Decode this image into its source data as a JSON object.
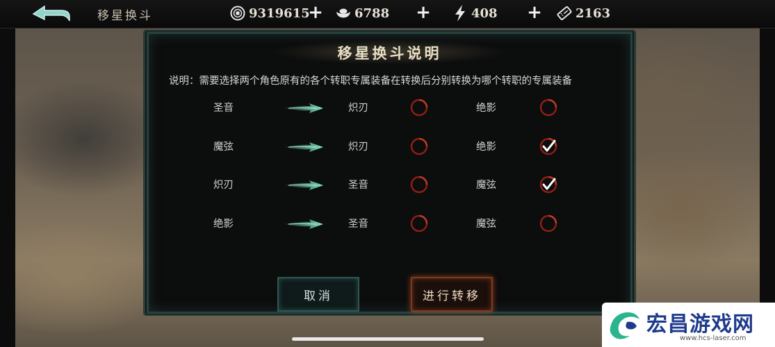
{
  "topbar": {
    "screen_title": "移星换斗",
    "back_icon": "back-arrow-icon",
    "resources": [
      {
        "name": "coin",
        "icon": "coin-icon",
        "value": "9319615"
      },
      {
        "name": "silver",
        "icon": "silver-ingot-icon",
        "value": "6788"
      },
      {
        "name": "stamina",
        "icon": "lightning-icon",
        "value": "408"
      },
      {
        "name": "ticket",
        "icon": "ticket-icon",
        "value": "2163"
      }
    ],
    "plus_label": "+"
  },
  "dialog": {
    "title": "移星换斗说明",
    "description": "说明：需要选择两个角色原有的各个转职专属装备在转换后分别转换为哪个转职的专属装备",
    "rows": [
      {
        "source": "圣音",
        "option_a": "炽刃",
        "option_a_checked": false,
        "option_b": "绝影",
        "option_b_checked": false
      },
      {
        "source": "魔弦",
        "option_a": "炽刃",
        "option_a_checked": false,
        "option_b": "绝影",
        "option_b_checked": true
      },
      {
        "source": "炽刃",
        "option_a": "圣音",
        "option_a_checked": false,
        "option_b": "魔弦",
        "option_b_checked": true
      },
      {
        "source": "绝影",
        "option_a": "圣音",
        "option_a_checked": false,
        "option_b": "魔弦",
        "option_b_checked": false
      }
    ],
    "cancel_label": "取消",
    "confirm_label": "进行转移"
  },
  "watermark": {
    "text": "宏昌游戏网",
    "url": "www.hcs-laser.com"
  },
  "colors": {
    "accent_teal": "#2e5652",
    "accent_red": "#a02418",
    "arrow_green": "#6fe8c0"
  }
}
